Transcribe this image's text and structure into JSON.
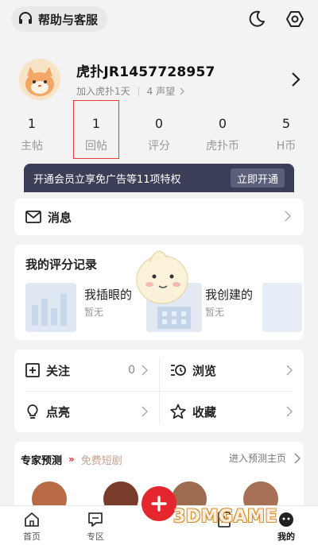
{
  "header": {
    "help_label": "帮助与客服",
    "icons": [
      "headset-icon",
      "moon-icon",
      "settings-icon"
    ]
  },
  "profile": {
    "username": "虎扑JR1457728957",
    "joined": "加入虎扑1天",
    "reputation": "4 声望"
  },
  "stats": [
    {
      "value": "1",
      "label": "主帖"
    },
    {
      "value": "1",
      "label": "回帖"
    },
    {
      "value": "0",
      "label": "评分"
    },
    {
      "value": "0",
      "label": "虎扑币"
    },
    {
      "value": "5",
      "label": "H币"
    }
  ],
  "vip": {
    "text": "开通会员立享免广告等11项特权",
    "button": "立即开通"
  },
  "messages": {
    "label": "消息"
  },
  "ratings": {
    "title": "我的评分记录",
    "items": [
      {
        "name": "我插眼的",
        "sub": "暂无"
      },
      {
        "name": "我创建的",
        "sub": "暂无"
      }
    ]
  },
  "features": {
    "follow_label": "关注",
    "follow_count": "0",
    "browse_label": "浏览",
    "like_label": "点亮",
    "favorite_label": "收藏"
  },
  "expert": {
    "tab1": "专家预测",
    "tab2": "免费短剧",
    "link": "进入预测主页"
  },
  "nav": {
    "home": "首页",
    "zone": "专区",
    "mine": "我的"
  },
  "watermark": "3DMGAME",
  "colors": {
    "accent_red": "#e4262f",
    "vip_bg": "#3a3f57",
    "highlight_border": "#e43b3b"
  }
}
